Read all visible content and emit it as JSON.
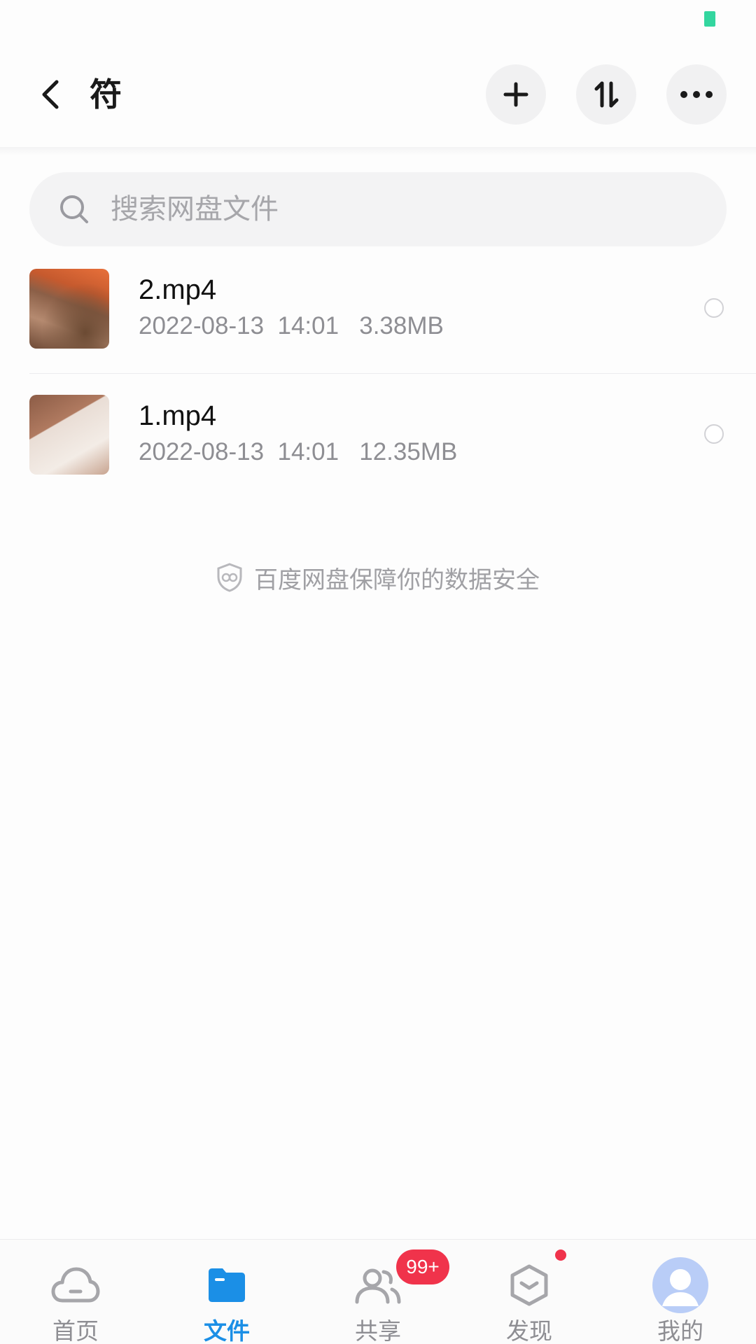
{
  "colors": {
    "accent": "#1b8fe6",
    "badge": "#f0334b",
    "battery": "#33d69f",
    "inactive": "#8e8e93",
    "avatar": "#b9cdf7"
  },
  "header": {
    "title": "符",
    "back_icon": "chevron-left-icon",
    "actions": [
      {
        "icon": "plus-icon"
      },
      {
        "icon": "sort-icon"
      },
      {
        "icon": "more-icon"
      }
    ]
  },
  "search": {
    "placeholder": "搜索网盘文件",
    "icon": "search-icon"
  },
  "files": [
    {
      "name": "2.mp4",
      "date": "2022-08-13",
      "time": "14:01",
      "size": "3.38MB",
      "meta": "2022-08-13  14:01   3.38MB",
      "selected": false
    },
    {
      "name": "1.mp4",
      "date": "2022-08-13",
      "time": "14:01",
      "size": "12.35MB",
      "meta": "2022-08-13  14:01   12.35MB",
      "selected": false
    }
  ],
  "security_notice": "百度网盘保障你的数据安全",
  "tabs": [
    {
      "label": "首页",
      "icon": "cloud-icon",
      "active": false
    },
    {
      "label": "文件",
      "icon": "folder-icon",
      "active": true
    },
    {
      "label": "共享",
      "icon": "people-icon",
      "active": false,
      "badge": "99+"
    },
    {
      "label": "发现",
      "icon": "discover-icon",
      "active": false,
      "dot": true
    },
    {
      "label": "我的",
      "icon": "avatar-icon",
      "active": false
    }
  ]
}
